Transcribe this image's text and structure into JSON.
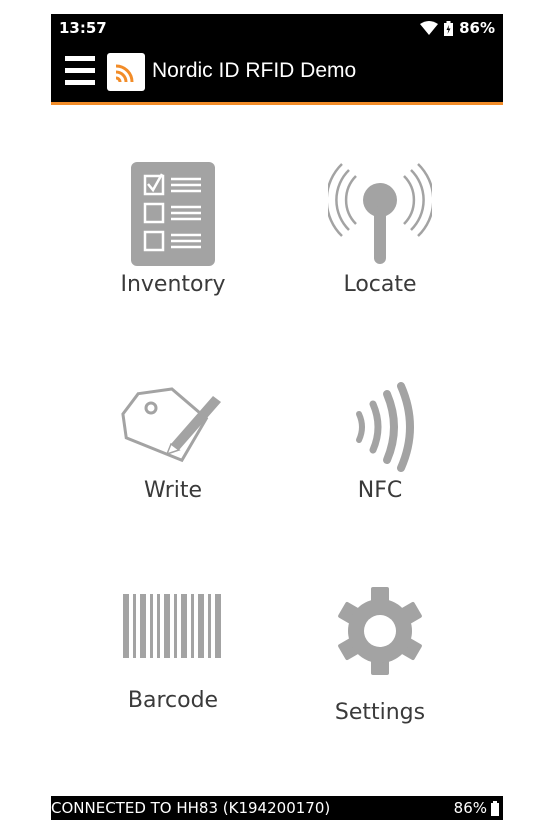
{
  "status_bar": {
    "time": "13:57",
    "battery": "86%",
    "icons": [
      "wifi-icon",
      "battery-icon"
    ]
  },
  "app_bar": {
    "title": "Nordic ID RFID Demo",
    "menu_icon": "hamburger-icon",
    "logo_icon": "rfid-logo-icon",
    "accent_color": "#f28c28"
  },
  "menu": [
    {
      "label": "Inventory",
      "icon": "inventory-icon"
    },
    {
      "label": "Locate",
      "icon": "locate-icon"
    },
    {
      "label": "Write",
      "icon": "write-icon"
    },
    {
      "label": "NFC",
      "icon": "nfc-icon"
    },
    {
      "label": "Barcode",
      "icon": "barcode-icon"
    },
    {
      "label": "Settings",
      "icon": "settings-icon"
    }
  ],
  "footer": {
    "connection": "CONNECTED TO HH83 (K194200170)",
    "battery": "86%"
  },
  "colors": {
    "icon_gray": "#a3a3a3",
    "bar_black": "#000000"
  }
}
